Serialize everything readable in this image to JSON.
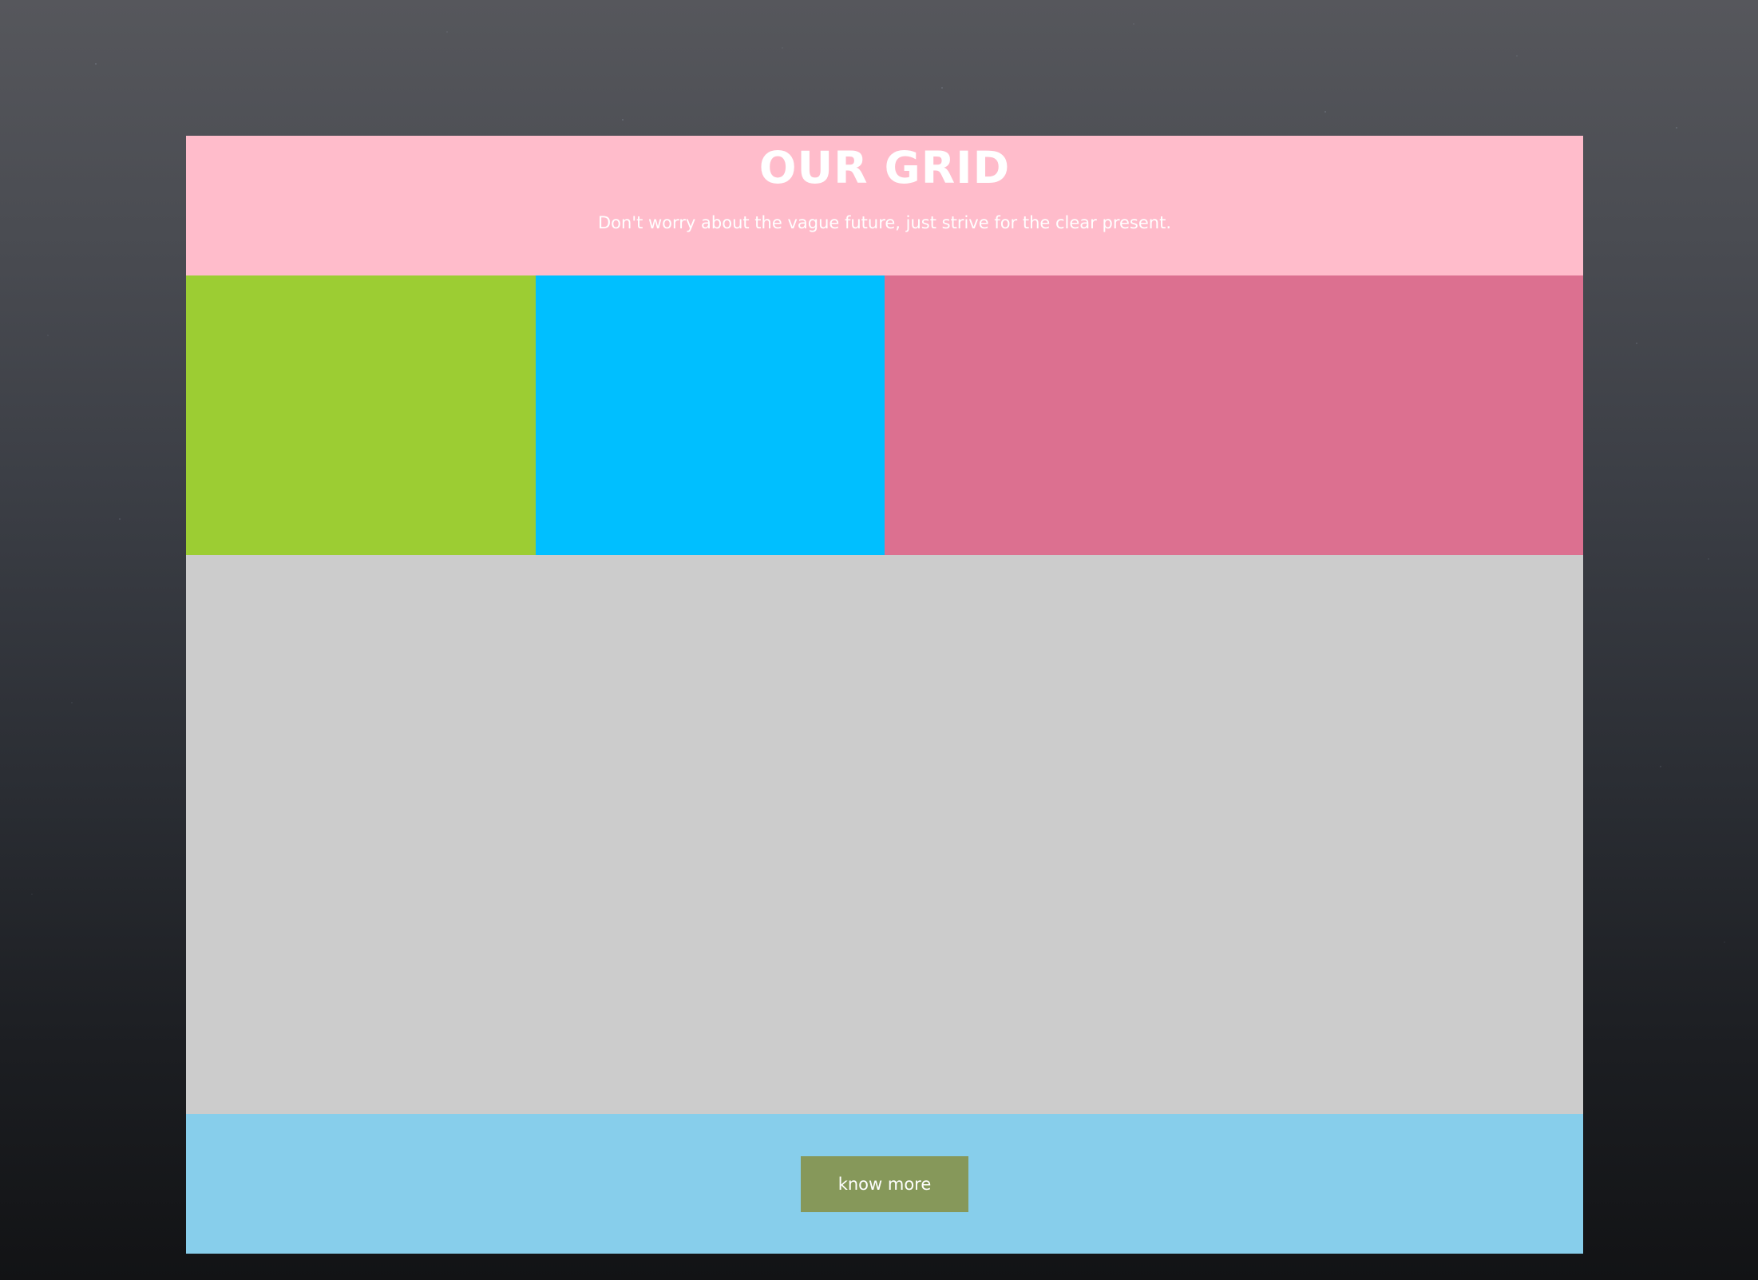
{
  "header": {
    "title": "OUR GRID",
    "subtitle": "Don't worry about the vague future, just strive for the clear present."
  },
  "grid": {
    "row1": [
      {
        "name": "green-block",
        "color": "#9ccd33"
      },
      {
        "name": "blue-block",
        "color": "#00bfff"
      },
      {
        "name": "rose-block",
        "color": "#dc7090"
      }
    ],
    "main_color": "#cccccc"
  },
  "footer": {
    "button_label": "know more",
    "background": "#87ceeb",
    "button_color": "#86985a"
  },
  "colors": {
    "header_bg": "#ffbccb",
    "text": "#ffffff"
  }
}
